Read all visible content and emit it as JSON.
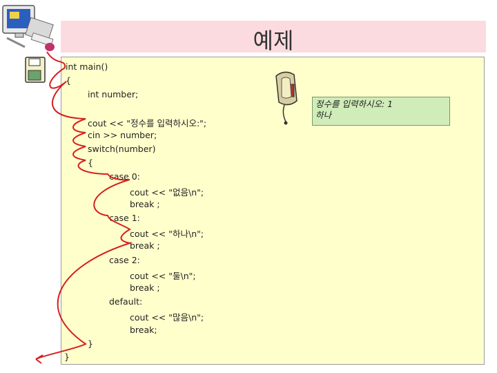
{
  "slide": {
    "title": "예제"
  },
  "code_lines": [
    "int main()",
    "{",
    "int number;",
    "cout << \"정수를 입력하시오:\";",
    "cin >> number;",
    "switch(number)",
    "{",
    "case 0:",
    "cout << \"없음\\n\";",
    "break ;",
    "case 1:",
    "cout << \"하나\\n\";",
    "break ;",
    "case 2:",
    "cout << \"둘\\n\";",
    "break ;",
    "default:",
    "cout << \"많음\\n\";",
    "break;",
    "}",
    "}"
  ],
  "console": {
    "lines": [
      "정수를 입력하시오: 1",
      "하나"
    ]
  },
  "icons": {
    "computer": "computer-clipart",
    "disk": "floppy-disk-icon",
    "mouse": "computer-mouse-clipart",
    "trace": "execution-trace-arrow"
  },
  "colors": {
    "title_bg": "#fcdbe0",
    "code_bg": "#ffffcc",
    "console_bg": "#cfecb9",
    "trace": "#d42020"
  }
}
